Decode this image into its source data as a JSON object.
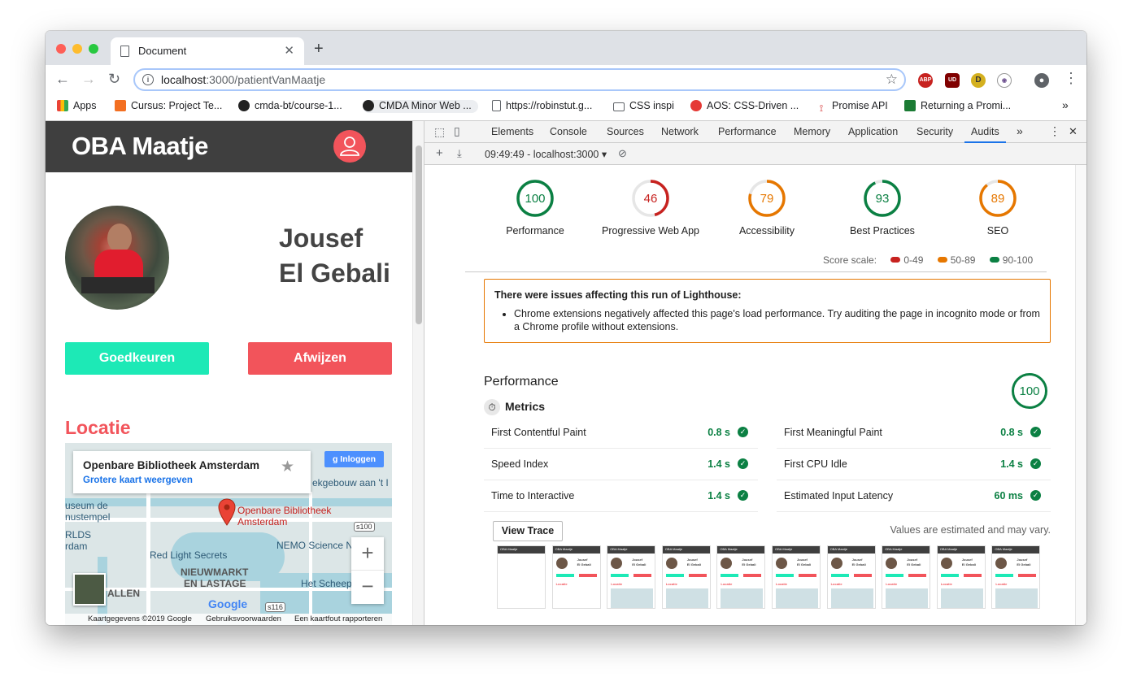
{
  "browser": {
    "tab_title": "Document",
    "url_host": "localhost",
    "url_path": ":3000/patientVanMaatje",
    "bookmarks": [
      "Apps",
      "Cursus: Project Te...",
      "cmda-bt/course-1...",
      "CMDA Minor Web ...",
      "https://robinstut.g...",
      "CSS inspi",
      "AOS: CSS-Driven ...",
      "Promise API",
      "Returning a Promi..."
    ],
    "extensions": [
      "ABP",
      "UD",
      "D",
      "eye"
    ],
    "colors": {
      "tabbar": "#dee1e6",
      "active_tab": "#ffffff"
    }
  },
  "app": {
    "title": "OBA Maatje",
    "patient_first": "Jousef",
    "patient_last": "El Gebali",
    "approve_label": "Goedkeuren",
    "reject_label": "Afwijzen",
    "location_heading": "Locatie",
    "colors": {
      "header": "#3f3f3f",
      "accent": "#f2545b",
      "approve": "#1de9b6"
    },
    "map": {
      "card_title": "Openbare Bibliotheek Amsterdam",
      "card_link": "Grotere kaart weergeven",
      "login_label": "Inloggen",
      "labels": [
        "ekgebouw aan 't I",
        "useum de",
        "nustempel",
        "RLDS",
        "rdam",
        "Red Light Secrets",
        "NEMO Science N",
        "NIEUWMARKT",
        "EN LASTAGE",
        "ALLEN",
        "Het Scheep"
      ],
      "pin_label_1": "Openbare Bibliotheek",
      "pin_label_2": "Amsterdam",
      "shield_1": "s100",
      "shield_2": "s116",
      "google": "Google",
      "footer_data": "Kaartgegevens ©2019 Google",
      "footer_terms": "Gebruiksvoorwaarden",
      "footer_report": "Een kaartfout rapporteren"
    }
  },
  "devtools": {
    "tabs": [
      "Elements",
      "Console",
      "Sources",
      "Network",
      "Performance",
      "Memory",
      "Application",
      "Security",
      "Audits"
    ],
    "active_tab": "Audits",
    "report_selector": "09:49:49 - localhost:3000",
    "scores": [
      {
        "label": "Performance",
        "value": "100",
        "color": "#0b8043"
      },
      {
        "label": "Progressive Web App",
        "value": "46",
        "color": "#c7221f"
      },
      {
        "label": "Accessibility",
        "value": "79",
        "color": "#e67700"
      },
      {
        "label": "Best Practices",
        "value": "93",
        "color": "#0b8043"
      },
      {
        "label": "SEO",
        "value": "89",
        "color": "#e67700"
      }
    ],
    "score_scale": {
      "label": "Score scale:",
      "low": "0-49",
      "mid": "50-89",
      "high": "90-100"
    },
    "warning": {
      "heading": "There were issues affecting this run of Lighthouse:",
      "item": "Chrome extensions negatively affected this page's load performance. Try auditing the page in incognito mode or from a Chrome profile without extensions."
    },
    "performance": {
      "title": "Performance",
      "score": "100",
      "metrics_heading": "Metrics",
      "metrics_left": [
        {
          "name": "First Contentful Paint",
          "value": "0.8 s"
        },
        {
          "name": "Speed Index",
          "value": "1.4 s"
        },
        {
          "name": "Time to Interactive",
          "value": "1.4 s"
        }
      ],
      "metrics_right": [
        {
          "name": "First Meaningful Paint",
          "value": "0.8 s"
        },
        {
          "name": "First CPU Idle",
          "value": "1.4 s"
        },
        {
          "name": "Estimated Input Latency",
          "value": "60 ms"
        }
      ],
      "view_trace": "View Trace",
      "estimate_note": "Values are estimated and may vary.",
      "filmstrip_title": "OBA Maatje",
      "filmstrip_name_1": "Jousef",
      "filmstrip_name_2": "El Gebali",
      "filmstrip_location": "Locatie"
    }
  }
}
